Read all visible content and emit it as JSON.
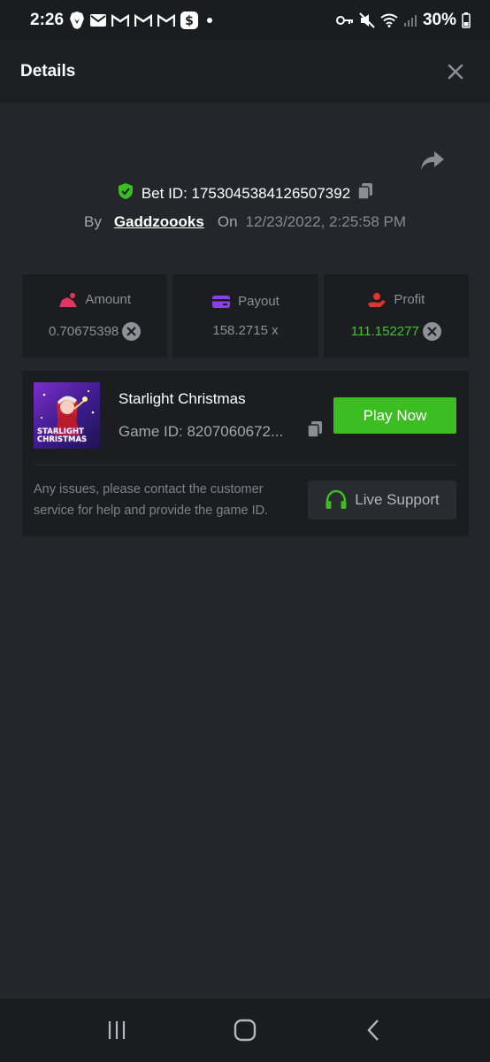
{
  "status_bar": {
    "time": "2:26",
    "battery": "30%"
  },
  "header": {
    "title": "Details"
  },
  "bet": {
    "bet_id_label": "Bet ID: 1753045384126507392",
    "by_label": "By",
    "username": "Gaddzoooks",
    "on_label": "On",
    "datetime": "12/23/2022, 2:25:58 PM"
  },
  "stats": [
    {
      "label": "Amount",
      "value": "0.70675398"
    },
    {
      "label": "Payout",
      "value": "158.2715 x"
    },
    {
      "label": "Profit",
      "value": "111.152277"
    }
  ],
  "game": {
    "thumb_title": "STARLIGHT CHRISTMAS",
    "name": "Starlight Christmas",
    "game_id": "Game ID: 8207060672...",
    "play_label": "Play Now",
    "help_text": "Any issues, please contact the customer service for help and provide the game ID.",
    "support_label": "Live Support"
  },
  "colors": {
    "accent_green": "#3cbe23",
    "profit_green": "#3fc52a",
    "amount_pink": "#e0365f",
    "payout_purple": "#8b3ff0",
    "profit_red": "#e0342c"
  }
}
